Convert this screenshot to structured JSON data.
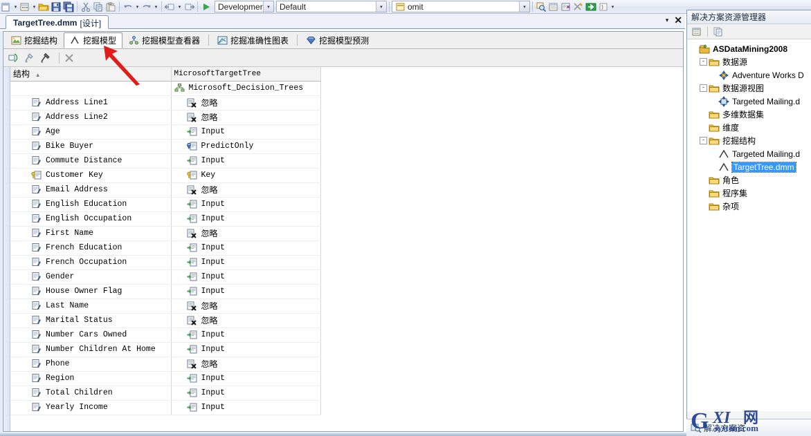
{
  "toolbar": {
    "combo_configuration": "Developmer",
    "combo_platform": "Default",
    "combo_project": "omit",
    "icons": [
      "new-item-icon",
      "open-folder-icon",
      "save-icon",
      "save-all-icon",
      "cut-icon",
      "copy-icon",
      "paste-icon",
      "undo-icon",
      "redo-icon",
      "navigate-back-icon",
      "navigate-forward-icon",
      "start-debug-icon",
      "find-icon",
      "properties-window-icon",
      "object-browser-icon",
      "tools-icon",
      "deploy-icon",
      "toolbox-icon"
    ]
  },
  "document_tab": {
    "title": "TargetTree.dmm",
    "mode": "[设计]",
    "dropdown_glyph": "▾",
    "close_glyph": "✕"
  },
  "designer": {
    "tabs": [
      {
        "label": "挖掘结构",
        "icon": "mining-structure-icon",
        "active": false
      },
      {
        "label": "挖掘模型",
        "icon": "mining-model-icon",
        "active": true
      },
      {
        "label": "挖掘模型查看器",
        "icon": "mining-model-viewer-icon",
        "active": false
      },
      {
        "label": "挖掘准确性图表",
        "icon": "accuracy-chart-icon",
        "active": false
      },
      {
        "label": "挖掘模型预测",
        "icon": "prediction-icon",
        "active": false
      }
    ],
    "toolbar_buttons": [
      "create-related-model-icon",
      "set-model-parameters-icon",
      "process-model-icon",
      "delete-model-icon"
    ],
    "grid": {
      "columns": [
        {
          "label": "结构",
          "sort": "▴"
        },
        {
          "label": "MicrosoftTargetTree"
        }
      ],
      "algorithm_row": {
        "icon": "decision-tree-icon",
        "value": "Microsoft_Decision_Trees"
      },
      "rows": [
        {
          "icon": "column-icon",
          "name": "Address Line1",
          "usage_icon": "ignore-icon",
          "usage": "忽略",
          "cjk": true
        },
        {
          "icon": "column-icon",
          "name": "Address Line2",
          "usage_icon": "ignore-icon",
          "usage": "忽略",
          "cjk": true
        },
        {
          "icon": "column-icon",
          "name": "Age",
          "usage_icon": "input-icon",
          "usage": "Input",
          "cjk": false
        },
        {
          "icon": "column-icon",
          "name": "Bike Buyer",
          "usage_icon": "predictonly-icon",
          "usage": "PredictOnly",
          "cjk": false
        },
        {
          "icon": "column-icon",
          "name": "Commute Distance",
          "usage_icon": "input-icon",
          "usage": "Input",
          "cjk": false
        },
        {
          "icon": "key-column-icon",
          "name": "Customer Key",
          "usage_icon": "key-icon",
          "usage": "Key",
          "cjk": false
        },
        {
          "icon": "column-icon",
          "name": "Email Address",
          "usage_icon": "ignore-icon",
          "usage": "忽略",
          "cjk": true
        },
        {
          "icon": "column-icon",
          "name": "English Education",
          "usage_icon": "input-icon",
          "usage": "Input",
          "cjk": false
        },
        {
          "icon": "column-icon",
          "name": "English Occupation",
          "usage_icon": "input-icon",
          "usage": "Input",
          "cjk": false
        },
        {
          "icon": "column-icon",
          "name": "First Name",
          "usage_icon": "ignore-icon",
          "usage": "忽略",
          "cjk": true
        },
        {
          "icon": "column-icon",
          "name": "French Education",
          "usage_icon": "input-icon",
          "usage": "Input",
          "cjk": false
        },
        {
          "icon": "column-icon",
          "name": "French Occupation",
          "usage_icon": "input-icon",
          "usage": "Input",
          "cjk": false
        },
        {
          "icon": "column-icon",
          "name": "Gender",
          "usage_icon": "input-icon",
          "usage": "Input",
          "cjk": false
        },
        {
          "icon": "column-icon",
          "name": "House Owner Flag",
          "usage_icon": "input-icon",
          "usage": "Input",
          "cjk": false
        },
        {
          "icon": "column-icon",
          "name": "Last Name",
          "usage_icon": "ignore-icon",
          "usage": "忽略",
          "cjk": true
        },
        {
          "icon": "column-icon",
          "name": "Marital Status",
          "usage_icon": "ignore-icon",
          "usage": "忽略",
          "cjk": true
        },
        {
          "icon": "column-icon",
          "name": "Number Cars Owned",
          "usage_icon": "input-icon",
          "usage": "Input",
          "cjk": false
        },
        {
          "icon": "column-icon",
          "name": "Number Children At Home",
          "usage_icon": "input-icon",
          "usage": "Input",
          "cjk": false
        },
        {
          "icon": "column-icon",
          "name": "Phone",
          "usage_icon": "ignore-icon",
          "usage": "忽略",
          "cjk": true
        },
        {
          "icon": "column-icon",
          "name": "Region",
          "usage_icon": "input-icon",
          "usage": "Input",
          "cjk": false
        },
        {
          "icon": "column-icon",
          "name": "Total Children",
          "usage_icon": "input-icon",
          "usage": "Input",
          "cjk": false
        },
        {
          "icon": "column-icon",
          "name": "Yearly Income",
          "usage_icon": "input-icon",
          "usage": "Input",
          "cjk": false
        }
      ]
    }
  },
  "solution_explorer": {
    "title": "解决方案资源管理器",
    "toolbar_buttons": [
      "properties-icon",
      "show-all-files-icon"
    ],
    "tree": [
      {
        "label": "ASDataMining2008",
        "icon": "solution-icon",
        "depth": 0,
        "expander": "",
        "root": true,
        "selected": false
      },
      {
        "label": "数据源",
        "icon": "folder-icon",
        "depth": 1,
        "expander": "-",
        "root": false,
        "selected": false
      },
      {
        "label": "Adventure Works D",
        "icon": "datasource-icon",
        "depth": 2,
        "expander": "",
        "root": false,
        "selected": false
      },
      {
        "label": "数据源视图",
        "icon": "folder-icon",
        "depth": 1,
        "expander": "-",
        "root": false,
        "selected": false
      },
      {
        "label": "Targeted Mailing.d",
        "icon": "dsv-icon",
        "depth": 2,
        "expander": "",
        "root": false,
        "selected": false
      },
      {
        "label": "多维数据集",
        "icon": "folder-icon",
        "depth": 1,
        "expander": "",
        "root": false,
        "selected": false
      },
      {
        "label": "维度",
        "icon": "folder-icon",
        "depth": 1,
        "expander": "",
        "root": false,
        "selected": false
      },
      {
        "label": "挖掘结构",
        "icon": "folder-icon",
        "depth": 1,
        "expander": "-",
        "root": false,
        "selected": false
      },
      {
        "label": "Targeted Mailing.d",
        "icon": "mining-model-icon",
        "depth": 2,
        "expander": "",
        "root": false,
        "selected": false
      },
      {
        "label": "TargetTree.dmm",
        "icon": "mining-model-icon",
        "depth": 2,
        "expander": "",
        "root": false,
        "selected": true
      },
      {
        "label": "角色",
        "icon": "folder-icon",
        "depth": 1,
        "expander": "",
        "root": false,
        "selected": false
      },
      {
        "label": "程序集",
        "icon": "folder-icon",
        "depth": 1,
        "expander": "",
        "root": false,
        "selected": false
      },
      {
        "label": "杂项",
        "icon": "folder-icon",
        "depth": 1,
        "expander": "",
        "root": false,
        "selected": false
      }
    ],
    "bottom_tab": {
      "label": "解决方案资",
      "icon": "solution-explorer-icon"
    }
  },
  "annotation": {
    "type": "red-arrow",
    "points_to": "挖掘模型",
    "color": "#e21b1b"
  },
  "watermark": {
    "text_main": "GXI网",
    "text_sub": "system.com"
  },
  "colors": {
    "selection_blue": "#3399ff",
    "toolbar_bg": "#e9edf6",
    "panel_border": "#7f9db9",
    "annotation_red": "#e21b1b"
  }
}
